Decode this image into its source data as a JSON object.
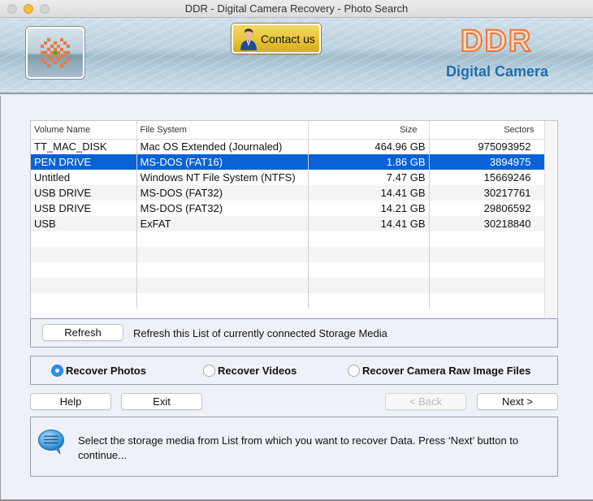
{
  "window": {
    "title": "DDR - Digital Camera Recovery - Photo Search"
  },
  "header": {
    "contact_label": "Contact us",
    "brand_name": "DDR",
    "brand_subtitle": "Digital Camera",
    "logo_icon": "app-logo-icon",
    "contact_icon": "person-icon"
  },
  "volumes": {
    "columns": [
      "Volume Name",
      "File System",
      "Size",
      "Sectors"
    ],
    "rows": [
      {
        "name": "TT_MAC_DISK",
        "fs": "Mac OS Extended (Journaled)",
        "size": "464.96  GB",
        "sectors": "975093952",
        "selected": false
      },
      {
        "name": "PEN DRIVE",
        "fs": "MS-DOS (FAT16)",
        "size": "1.86  GB",
        "sectors": "3894975",
        "selected": true
      },
      {
        "name": "Untitled",
        "fs": "Windows NT File System (NTFS)",
        "size": "7.47  GB",
        "sectors": "15669246",
        "selected": false
      },
      {
        "name": "USB DRIVE",
        "fs": "MS-DOS (FAT32)",
        "size": "14.41  GB",
        "sectors": "30217761",
        "selected": false
      },
      {
        "name": "USB DRIVE",
        "fs": "MS-DOS (FAT32)",
        "size": "14.21  GB",
        "sectors": "29806592",
        "selected": false
      },
      {
        "name": "USB",
        "fs": "ExFAT",
        "size": "14.41  GB",
        "sectors": "30218840",
        "selected": false
      }
    ],
    "selection_color": "#0b62d6"
  },
  "refresh": {
    "button_label": "Refresh",
    "description": "Refresh this List of currently connected Storage Media"
  },
  "recovery_options": {
    "selected": "Recover Photos",
    "options": [
      "Recover Photos",
      "Recover Videos",
      "Recover Camera Raw Image Files"
    ]
  },
  "nav": {
    "help_label": "Help",
    "exit_label": "Exit",
    "back_label": "< Back",
    "back_enabled": false,
    "next_label": "Next >"
  },
  "info": {
    "icon": "speech-bubble-icon",
    "message": "Select the storage media from List from which you want to recover Data. Press ‘Next’ button to continue..."
  }
}
